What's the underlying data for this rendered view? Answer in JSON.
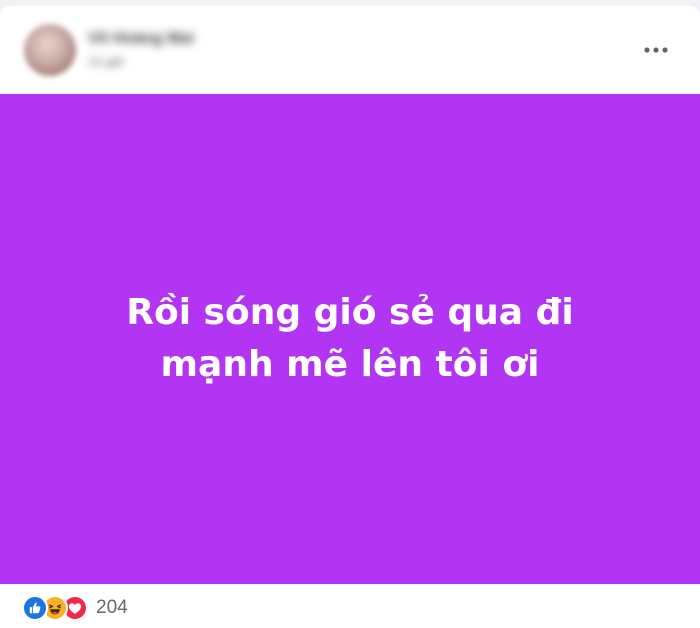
{
  "post": {
    "author_name": "Võ Hoàng Mai",
    "time": "13 giờ",
    "background_color": "#b235f3",
    "text": "Rồi sóng gió sẻ qua đi\nmạnh mẽ lên tôi ơi",
    "reactions": {
      "icons": [
        "like-icon",
        "haha-icon",
        "love-icon"
      ],
      "count": "204"
    },
    "more_icon": "more-horizontal-icon"
  }
}
